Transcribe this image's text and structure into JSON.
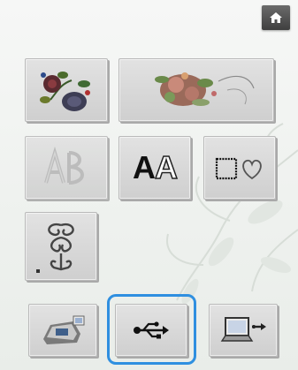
{
  "screen": {
    "title": ""
  },
  "buttons": {
    "home": {
      "icon": "home-icon"
    },
    "embroidery_single": {
      "icon": "floral-embroidery-icon"
    },
    "embroidery_bouquet": {
      "icon": "bouquet-embroidery-icon"
    },
    "monogram": {
      "icon": "monogram-icon"
    },
    "character": {
      "icon": "character-font-icon",
      "label": "A",
      "label_outline": "A"
    },
    "frame": {
      "icon": "frame-heart-icon"
    },
    "utility": {
      "icon": "scroll-motif-icon"
    },
    "machine_memory": {
      "icon": "sewing-machine-icon"
    },
    "usb": {
      "icon": "usb-icon"
    },
    "computer": {
      "icon": "computer-transfer-icon"
    }
  },
  "colors": {
    "highlight": "#2f8fe0",
    "home_bg": "#4a4a4a"
  }
}
